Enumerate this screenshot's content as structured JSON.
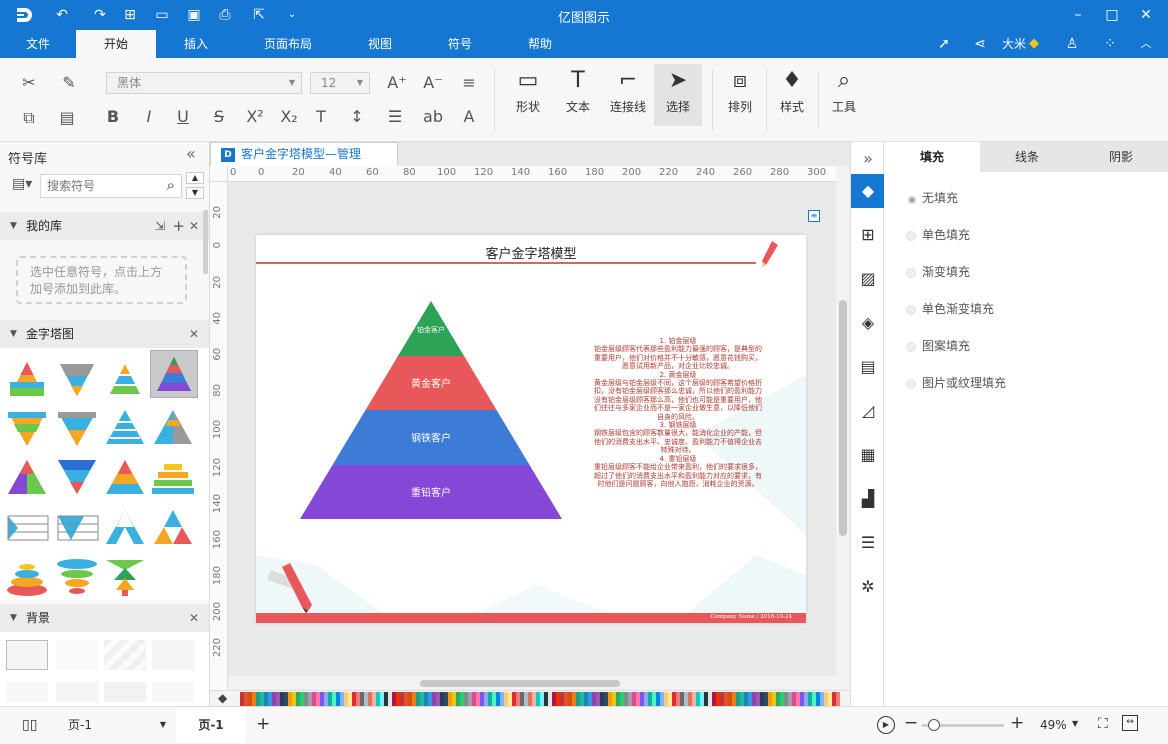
{
  "app": {
    "title": "亿图图示"
  },
  "menu": {
    "tabs": [
      "文件",
      "开始",
      "插入",
      "页面布局",
      "视图",
      "符号",
      "帮助"
    ],
    "active": "开始",
    "user": "大米"
  },
  "ribbon": {
    "font_name": "黑体",
    "font_size": "12",
    "tools": {
      "shape": "形状",
      "text": "文本",
      "connector": "连接线",
      "select": "选择",
      "arrange": "排列",
      "style": "样式",
      "tools": "工具"
    }
  },
  "library": {
    "title": "符号库",
    "search_placeholder": "搜索符号",
    "my_library": "我的库",
    "my_library_hint": "选中任意符号，点击上方加号添加到此库。",
    "pyramid_section": "金字塔图",
    "background_section": "背景"
  },
  "document": {
    "tab_title": "客户金字塔模型—管理",
    "ruler_h": [
      "0",
      "0",
      "20",
      "40",
      "60",
      "80",
      "100",
      "120",
      "140",
      "160",
      "180",
      "200",
      "220",
      "240",
      "260",
      "280",
      "300"
    ],
    "ruler_v": [
      "20",
      "0",
      "20",
      "40",
      "60",
      "80",
      "100",
      "120",
      "140",
      "160",
      "180",
      "200",
      "220"
    ],
    "page_title": "客户金字塔模型",
    "footer_text": "Company Name / 2016-10-24",
    "pyramid": [
      {
        "label": "铂金客户",
        "color": "#2ea257"
      },
      {
        "label": "黄金客户",
        "color": "#e8575a"
      },
      {
        "label": "钢铁客户",
        "color": "#3c7bd6"
      },
      {
        "label": "重铅客户",
        "color": "#8547d6"
      }
    ],
    "desc": [
      "1. 铂金层级",
      "铂金层级顾客代表那些盈利能力最强的顾客，是典型的",
      "重要用户，他们对价格并不十分敏感，愿意花钱购买，",
      "愿意试用新产品，对企业比较忠诚。",
      "2. 黄金层级",
      "黄金层级与铂金层级不同，这个层级的顾客希望价格折",
      "扣，没有铂金层级顾客那么忠诚，所以他们的盈利能力",
      "没有铂金层级顾客那么高，他们也可能是重要用户，他",
      "们往往与多家企业而不是一家企业做生意，以降低他们",
      "自身的风险。",
      "3. 钢铁层级",
      "钢铁层级包含的顾客数量很大，能消化企业的产能，但",
      "他们的消费支出水平、忠诚度、盈利能力不值得企业去",
      "特殊对待。",
      "4. 重铅层级",
      "重铅层级顾客不能给企业带来盈利，他们的要求很多，",
      "超过了他们的消费支出水平和盈利能力对应的要求，有",
      "时他们是问题顾客，向他人抱怨，消耗企业的资源。"
    ]
  },
  "fill_panel": {
    "tabs": [
      "填充",
      "线条",
      "阴影"
    ],
    "options": [
      "无填充",
      "单色填充",
      "渐变填充",
      "单色渐变填充",
      "图案填充",
      "图片或纹理填充"
    ]
  },
  "status": {
    "page_select": "页-1",
    "page_tab": "页-1",
    "zoom": "49%"
  },
  "colors": {
    "accent": "#1677d2",
    "footer_bar": "#e8575a"
  }
}
